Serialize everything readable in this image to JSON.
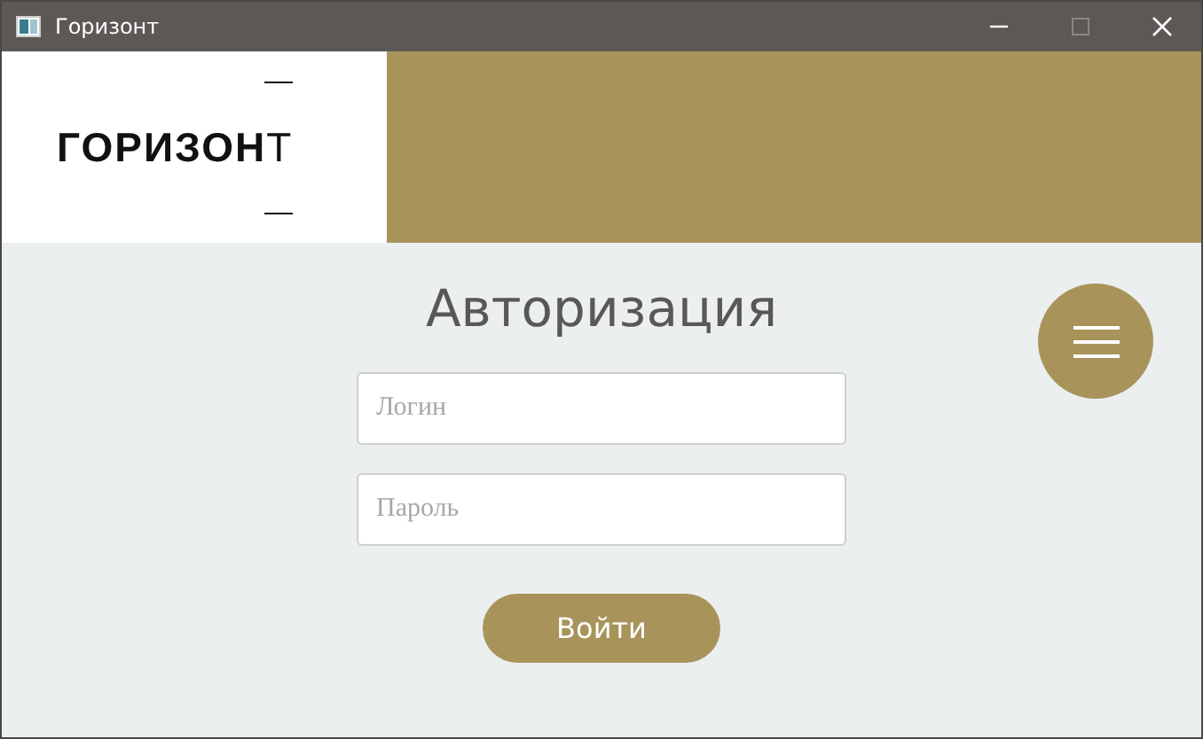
{
  "window": {
    "title": "Горизонт"
  },
  "logo": {
    "text": "**ГОРИЗОН**Т"
  },
  "heading": "Авторизация",
  "fields": [
    {
      "placeholder": "Логин"
    },
    {
      "placeholder": "Пароль"
    }
  ],
  "login_button": "Войти"
}
